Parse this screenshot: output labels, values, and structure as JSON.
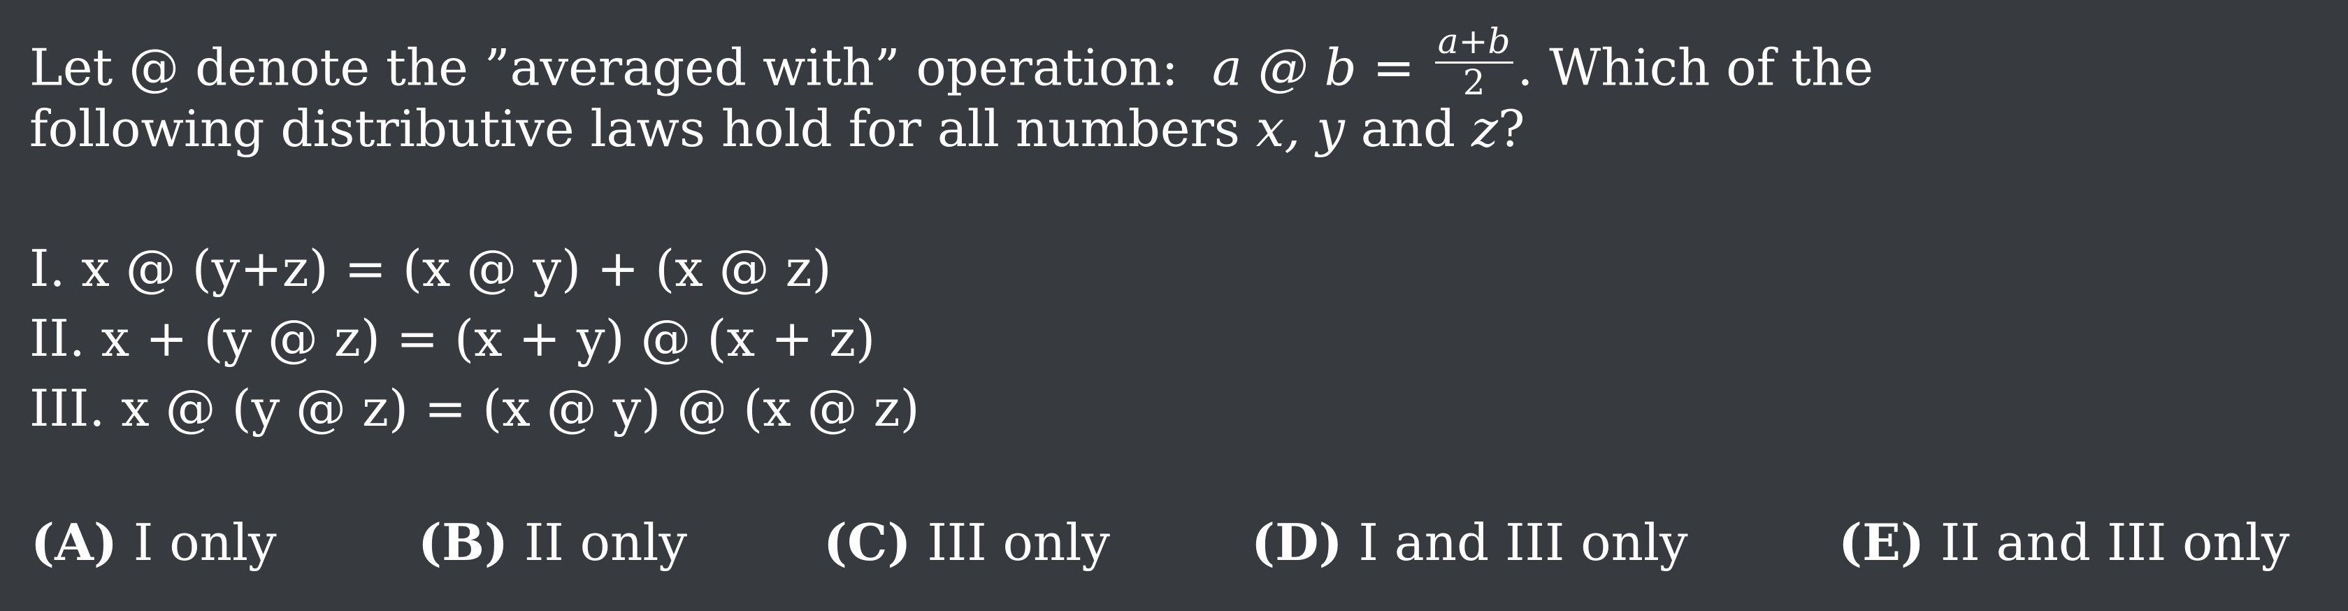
{
  "question": {
    "line1_prefix": "Let @ denote the ”averaged with” operation:",
    "formula_lhs": "a @ b =",
    "frac_num": "a+b",
    "frac_den": "2",
    "line1_suffix": ". Which of the",
    "line2_prefix": "following distributive laws hold for all numbers",
    "vars": "x, y",
    "line2_and": "and",
    "var_z": "z",
    "line2_end": "?"
  },
  "statements": [
    "I. x @ (y+z) = (x @ y) + (x @ z)",
    "II. x + (y @ z) = (x + y) @ (x + z)",
    "III. x @ (y @ z) = (x @ y) @ (x @ z)"
  ],
  "choices": [
    {
      "letter": "(A)",
      "text": "I only"
    },
    {
      "letter": "(B)",
      "text": "II only"
    },
    {
      "letter": "(C)",
      "text": "III only"
    },
    {
      "letter": "(D)",
      "text": "I and III only"
    },
    {
      "letter": "(E)",
      "text": "II and III only"
    }
  ]
}
